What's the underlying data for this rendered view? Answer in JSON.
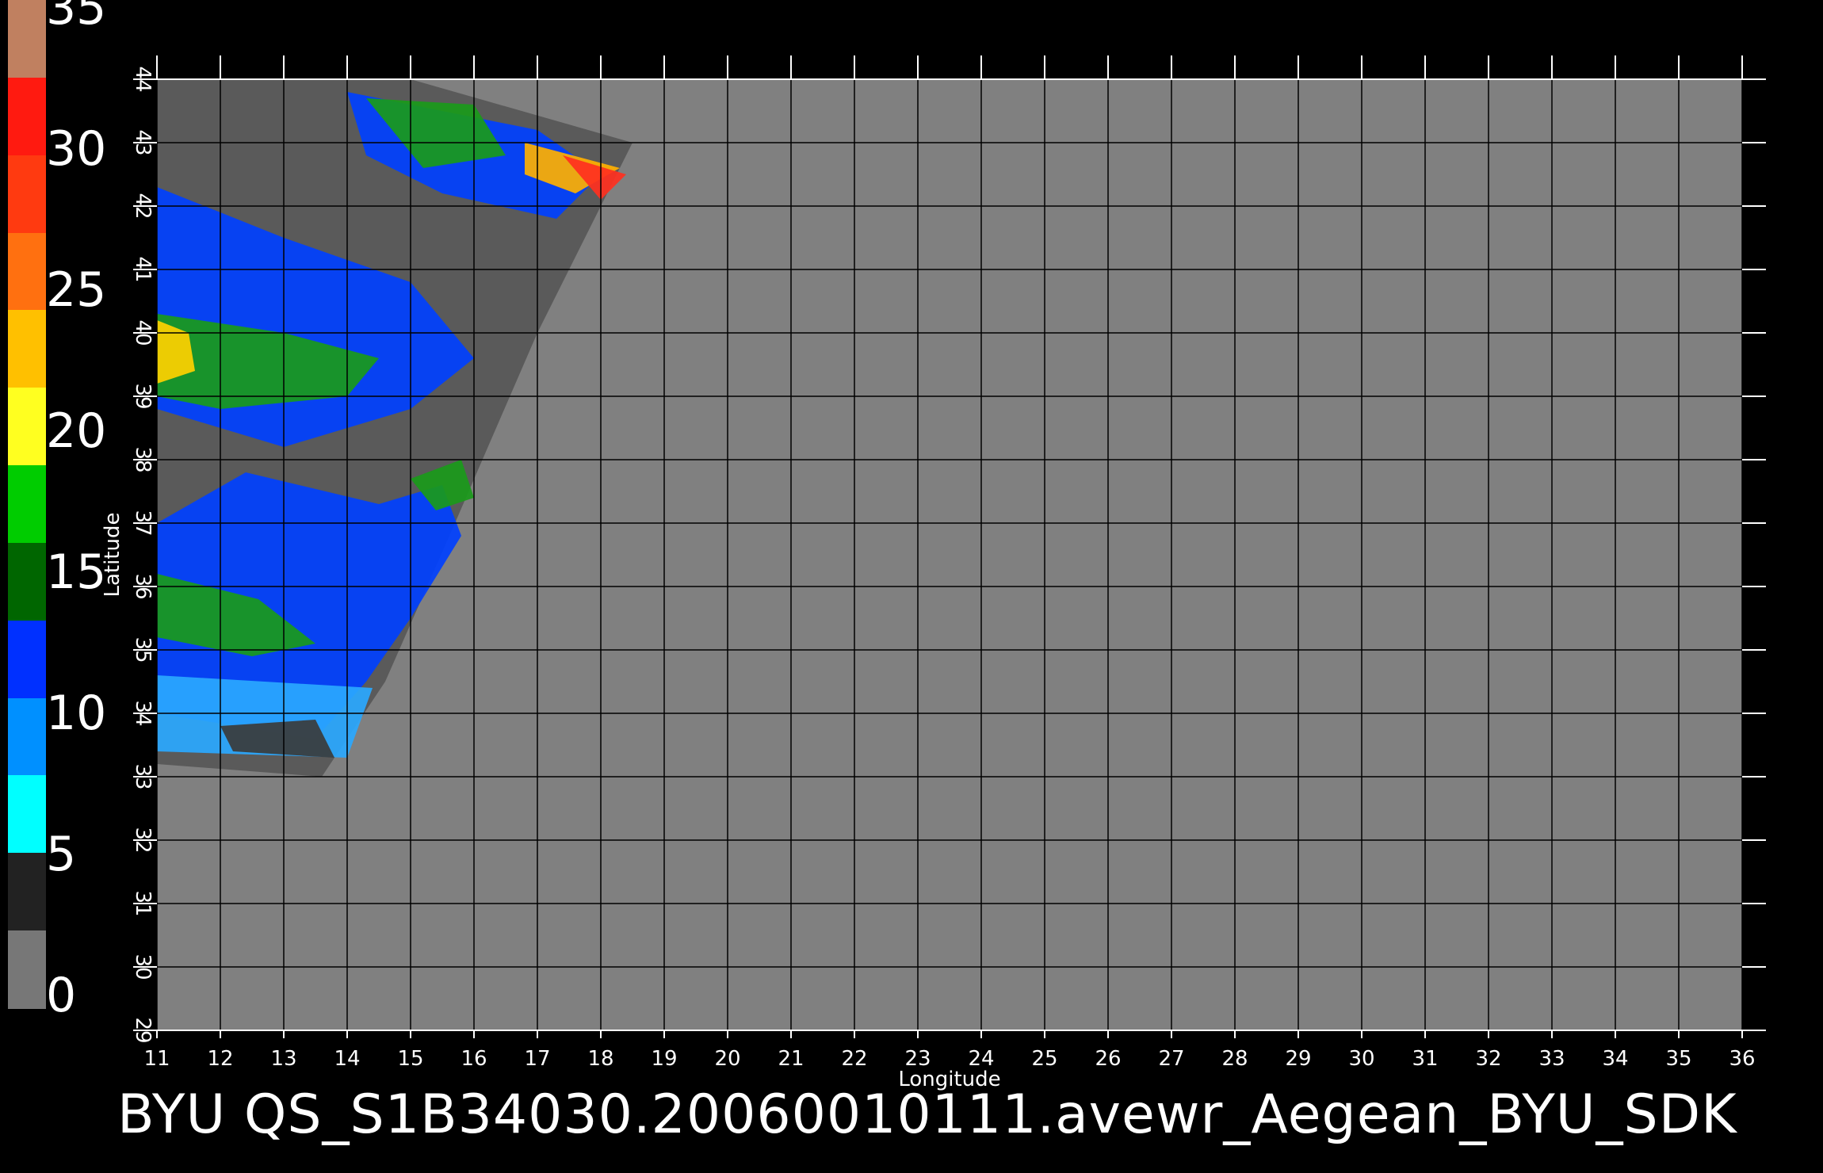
{
  "colorbar": {
    "labels": [
      "35",
      "30",
      "25",
      "20",
      "15",
      "10",
      "5",
      "0"
    ],
    "colors": [
      "#c08060",
      "#ff1a10",
      "#ff3a10",
      "#ff7010",
      "#ffc000",
      "#ffff20",
      "#00cc00",
      "#006600",
      "#0030ff",
      "#0090ff",
      "#00ffff",
      "#222222",
      "#777777"
    ]
  },
  "map": {
    "xlabel": "Longitude",
    "ylabel": "Latitude",
    "lon_ticks": [
      "11",
      "12",
      "13",
      "14",
      "15",
      "16",
      "17",
      "18",
      "19",
      "20",
      "21",
      "22",
      "23",
      "24",
      "25",
      "26",
      "27",
      "28",
      "29",
      "30",
      "31",
      "32",
      "33",
      "34",
      "35",
      "36"
    ],
    "lat_ticks": [
      "44",
      "43",
      "42",
      "41",
      "40",
      "39",
      "38",
      "37",
      "36",
      "35",
      "34",
      "33",
      "32",
      "31",
      "30",
      "29"
    ],
    "lon_range": [
      11,
      36
    ],
    "lat_range": [
      29,
      44
    ],
    "background_color": "#808080",
    "swath_color": "#5a5a5a",
    "grid_color": "#000000"
  },
  "title": "BYU  QS_S1B34030.20060010111.avewr_Aegean_BYU_SDK"
}
